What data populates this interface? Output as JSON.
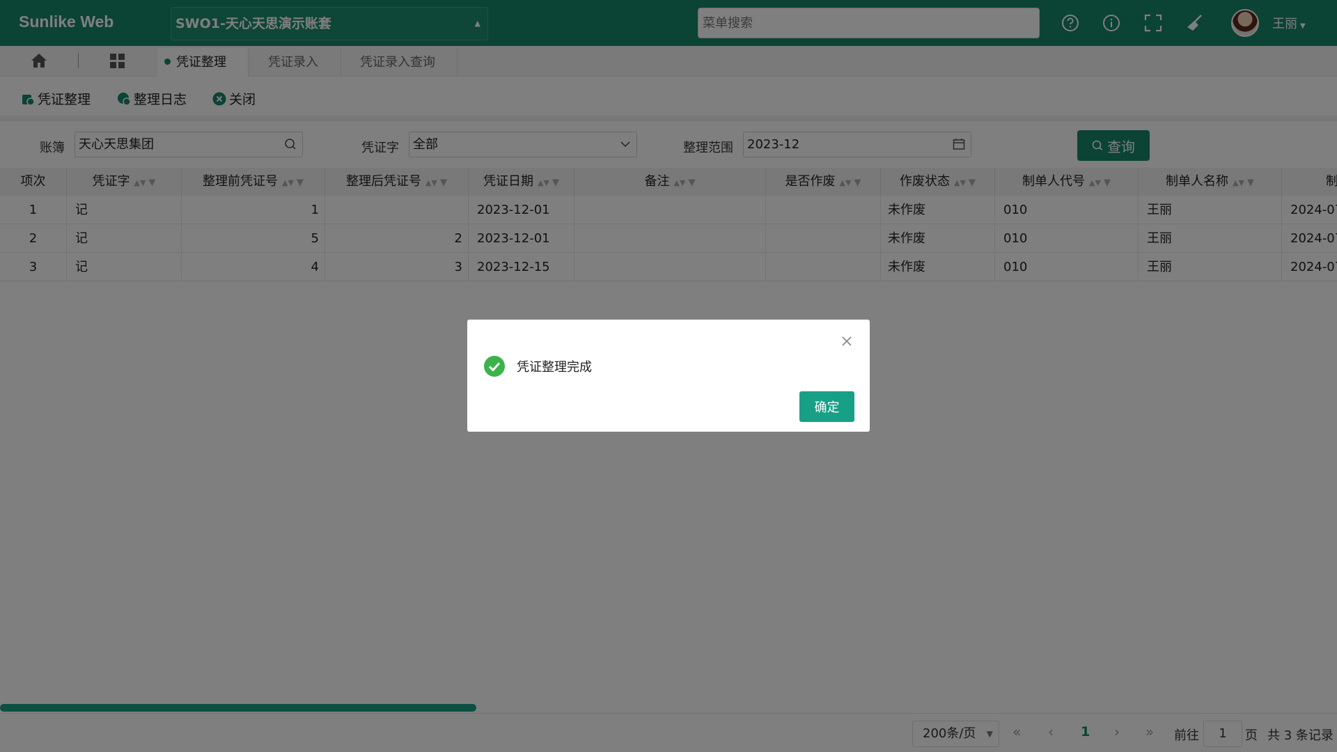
{
  "header": {
    "brand": "Sunlike Web",
    "account": "SWO1-天心天思演示账套",
    "search_placeholder": "菜单搜索",
    "user": "王丽",
    "icons": [
      "help-icon",
      "info-icon",
      "fullscreen-icon",
      "broom-icon"
    ]
  },
  "tabs": [
    {
      "label": "凭证整理",
      "active": true
    },
    {
      "label": "凭证录入",
      "active": false
    },
    {
      "label": "凭证录入查询",
      "active": false
    }
  ],
  "toolbar": {
    "organize": "凭证整理",
    "log": "整理日志",
    "close": "关闭"
  },
  "filters": {
    "ledger_label": "账簿",
    "ledger_value": "天心天思集团",
    "word_label": "凭证字",
    "word_value": "全部",
    "range_label": "整理范围",
    "range_value": "2023-12",
    "query_btn": "查询"
  },
  "table": {
    "columns": [
      "项次",
      "凭证字",
      "整理前凭证号",
      "整理后凭证号",
      "凭证日期",
      "备注",
      "是否作废",
      "作废状态",
      "制单人代号",
      "制单人名称",
      "制"
    ],
    "rows": [
      [
        "1",
        "记",
        "1",
        "",
        "2023-12-01",
        "",
        "",
        "未作废",
        "010",
        "王丽",
        "2024-07"
      ],
      [
        "2",
        "记",
        "5",
        "2",
        "2023-12-01",
        "",
        "",
        "未作废",
        "010",
        "王丽",
        "2024-07"
      ],
      [
        "3",
        "记",
        "4",
        "3",
        "2023-12-15",
        "",
        "",
        "未作废",
        "010",
        "王丽",
        "2024-07"
      ]
    ]
  },
  "pager": {
    "page_size": "200条/页",
    "current": "1",
    "goto_label": "前往",
    "goto_value": "1",
    "page_unit": "页",
    "total": "共 3 条记录"
  },
  "dialog": {
    "message": "凭证整理完成",
    "confirm": "确定"
  },
  "colors": {
    "brand": "#17876a",
    "accent": "#17a085",
    "success": "#3cb34a"
  }
}
